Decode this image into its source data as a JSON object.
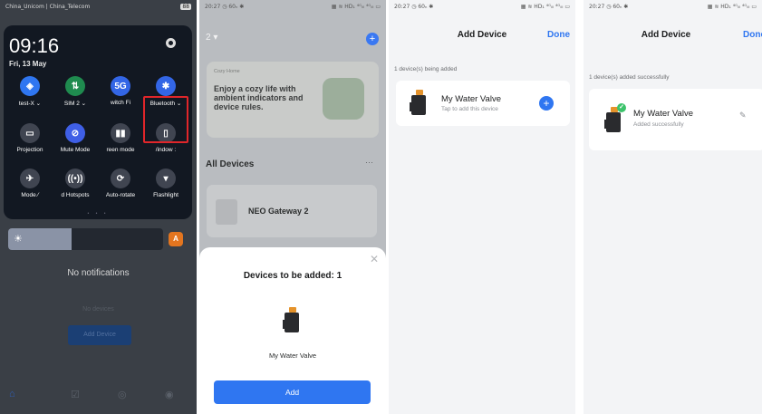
{
  "phone1": {
    "status": {
      "carrier": "China_Unicom | China_Telecom",
      "battery": "88"
    },
    "clock": "09:16",
    "date": "Fri, 13 May",
    "tiles_row1": [
      {
        "label": "test-X ⌄",
        "icon": "wifi-icon",
        "color": "#2f76f1",
        "glyph": "◈"
      },
      {
        "label": "SIM 2 ⌄",
        "icon": "mobile-data-icon",
        "color": "#1f8b4f",
        "glyph": "⇅"
      },
      {
        "label": "witch   Fi",
        "icon": "5g-icon",
        "color": "#3366e6",
        "glyph": "5G"
      },
      {
        "label": "Bluetooth ⌄",
        "icon": "bluetooth-icon",
        "color": "#3366e6",
        "glyph": "✱"
      }
    ],
    "tiles_row2": [
      {
        "label": "Projection",
        "icon": "projection-icon",
        "color": "#404551",
        "glyph": "▭"
      },
      {
        "label": "Mute Mode",
        "icon": "mute-icon",
        "color": "#3f5fe6",
        "glyph": "⊘"
      },
      {
        "label": "reen mode",
        "icon": "screen-mode-icon",
        "color": "#404551",
        "glyph": "▮▮"
      },
      {
        "label": "/indow   :",
        "icon": "window-icon",
        "color": "#404551",
        "glyph": "▯"
      }
    ],
    "tiles_row3": [
      {
        "label": "Mode  ⁄",
        "icon": "airplane-icon",
        "color": "#404551",
        "glyph": "✈"
      },
      {
        "label": "d Hotspots",
        "icon": "hotspot-icon",
        "color": "#404551",
        "glyph": "((•))"
      },
      {
        "label": "Auto-rotate",
        "icon": "rotate-icon",
        "color": "#404551",
        "glyph": "⟳"
      },
      {
        "label": "Flashlight",
        "icon": "flashlight-icon",
        "color": "#404551",
        "glyph": "▾"
      }
    ],
    "no_notifications": "No notifications",
    "no_devices": "No devices",
    "add_device": "Add Device",
    "brightness_fraction": 0.41
  },
  "phone2": {
    "status": {
      "time": "20:27 ◷ 60ₙ ✱",
      "right": "▦ ≋ HD₁ ⁴ᴳᵢₗₗ ⁴ᴳᵢₗₗ ▭"
    },
    "home_selector": "2 ▾",
    "banner_kicker": "Cozy Home",
    "banner_text": "Enjoy a cozy life with ambient indicators and device rules.",
    "all_devices": "All Devices",
    "more": "···",
    "gateway": "NEO Gateway 2",
    "sheet_title": "Devices to be added: 1",
    "device_name": "My Water Valve",
    "add_button": "Add"
  },
  "phone3": {
    "status": {
      "time": "20:27 ◷ 60ₙ ✱",
      "right": "▦ ≋ HD₁ ⁴ᴳᵢₗₗ ⁴ᴳᵢₗₗ ▭"
    },
    "title": "Add Device",
    "done": "Done",
    "subtitle": "1 device(s) being added",
    "device_name": "My Water Valve",
    "device_hint": "Tap to add this device"
  },
  "phone4": {
    "status": {
      "time": "20:27 ◷ 60ₙ ✱",
      "right": "▦ ≋ HD₁ ⁴ᴳᵢₗₗ ⁴ᴳᵢₗₗ ▭"
    },
    "title": "Add Device",
    "done": "Done",
    "subtitle": "1 device(s) added successfully",
    "device_name": "My Water Valve",
    "device_status": "Added successfully"
  }
}
